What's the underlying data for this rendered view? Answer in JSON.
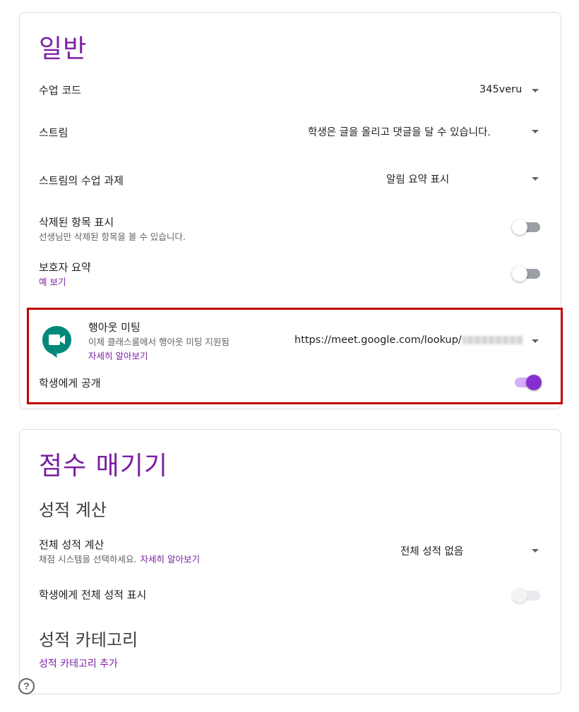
{
  "general": {
    "title": "일반",
    "class_code": {
      "label": "수업 코드",
      "value": "345veru"
    },
    "stream": {
      "label": "스트림",
      "value": "학생은 글을 올리고 댓글을 달 수 있습니다."
    },
    "classwork_on_stream": {
      "label": "스트림의 수업 과제",
      "value": "알림 요약 표시"
    },
    "show_deleted": {
      "label": "삭제된 항목 표시",
      "desc": "선생님만 삭제된 항목을 볼 수 있습니다.",
      "enabled": false
    },
    "guardian_summary": {
      "label": "보호자 요약",
      "link": "예 보기",
      "enabled": false
    },
    "meet": {
      "label": "행아웃 미팅",
      "desc": "이제 클래스룸에서 행아웃 미팅 지원됨",
      "link": "자세히 알아보기",
      "url": "https://meet.google.com/lookup/",
      "visible_label": "학생에게 공개",
      "visible_enabled": true
    }
  },
  "grading": {
    "title": "점수 매기기",
    "calc_title": "성적 계산",
    "overall_calc": {
      "label": "전체 성적 계산",
      "desc": "채점 시스템을 선택하세요.",
      "link": "자세히 알아보기",
      "value": "전체 성적 없음"
    },
    "show_overall": {
      "label": "학생에게 전체 성적 표시",
      "enabled": false
    },
    "categories_title": "성적 카테고리",
    "add_category": "성적 카테고리 추가"
  },
  "help_symbol": "?",
  "colors": {
    "accent": "#7b1fa2",
    "toggle_on": "#8430ce",
    "highlight": "#c00000",
    "meet_logo": "#00897b"
  }
}
